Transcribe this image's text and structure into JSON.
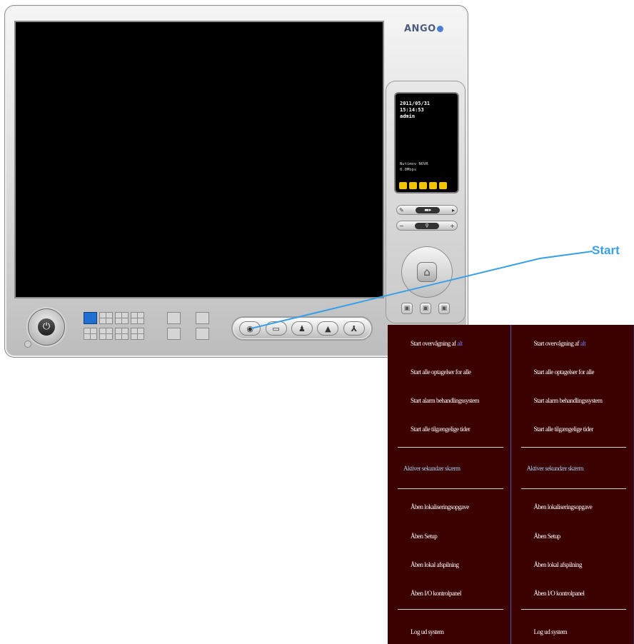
{
  "window": {
    "logo": "ANGO",
    "lcd": {
      "date": "2011/05/31",
      "time": "15:14:53",
      "user": "admin",
      "status_line1": "Nutimov NOVR",
      "status_line2": "0.0Mbps"
    },
    "ptz": {
      "home_icon": "home-icon",
      "zoom_minus": "−",
      "zoom_plus": "+"
    },
    "toolbar_buttons": [
      "start-icon",
      "camera-icon",
      "person-icon",
      "alert-icon",
      "tools-icon"
    ]
  },
  "callout": {
    "label": "Start",
    "color": "#3aa0e6"
  },
  "menu": {
    "background": "#3b0000",
    "columns": [
      {
        "group1": [
          {
            "text": "Start overvågning af ",
            "accent": "alt"
          },
          {
            "text": "Start alle optagelser for alle",
            "accent": ""
          },
          {
            "text": "Start alarm behandlingssystem",
            "accent": ""
          },
          {
            "text": "Start alle tilgængelige tider",
            "accent": ""
          }
        ],
        "highlight": "Aktiver sekundær skærm",
        "group2": [
          {
            "text": "Åben lokaliseringsopgave",
            "accent": ""
          },
          {
            "text": "Åben Setup",
            "accent": ""
          },
          {
            "text": "Åben lokal afspilning",
            "accent": ""
          },
          {
            "text": "Åben I/O kontrolpanel",
            "accent": ""
          }
        ],
        "last": "Log ud system"
      },
      {
        "group1": [
          {
            "text": "Start overvågning af ",
            "accent": "alt"
          },
          {
            "text": "Start alle optagelser for alle",
            "accent": ""
          },
          {
            "text": "Start alarm behandlingssystem",
            "accent": ""
          },
          {
            "text": "Start alle tilgængelige tider",
            "accent": ""
          }
        ],
        "highlight": "Aktiver sekundær skærm",
        "group2": [
          {
            "text": "Åben lokaliseringsopgave",
            "accent": ""
          },
          {
            "text": "Åben Setup",
            "accent": ""
          },
          {
            "text": "Åben lokal afspilning",
            "accent": ""
          },
          {
            "text": "Åben I/O kontrolpanel",
            "accent": ""
          }
        ],
        "last": "Log ud system"
      }
    ]
  }
}
